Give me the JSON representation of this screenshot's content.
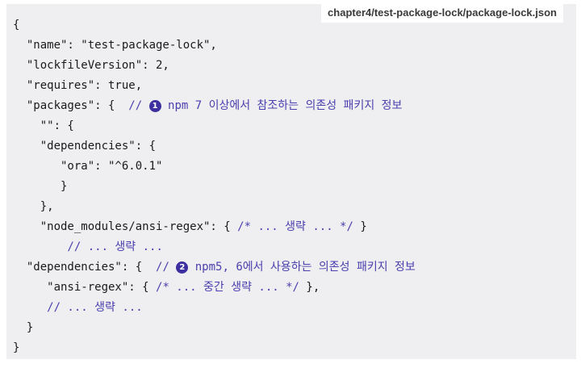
{
  "header": {
    "filename": "chapter4/test-package-lock/package-lock.json"
  },
  "code": {
    "l1": "{",
    "l2": "  \"name\": \"test-package-lock\",",
    "l3": "  \"lockfileVersion\": 2,",
    "l4": "  \"requires\": true,",
    "l5_code": "  \"packages\": {  ",
    "l5_c_pre": "// ",
    "l5_marker": "1",
    "l5_c_post": " npm 7 이상에서 참조하는 의존성 패키지 정보",
    "l6": "    \"\": {",
    "l7": "    \"dependencies\": {",
    "l8": "       \"ora\": \"^6.0.1\"",
    "l9": "       }",
    "l10": "    },",
    "l11_code": "    \"node_modules/ansi-regex\": { ",
    "l11_comment": "/* ... 생략 ... */",
    "l11_end": " }",
    "l12": "        // ... 생략 ...",
    "l13_code": "  \"dependencies\": {  ",
    "l13_c_pre": "// ",
    "l13_marker": "2",
    "l13_c_post": " npm5, 6에서 사용하는 의존성 패키지 정보",
    "l14_code": "     \"ansi-regex\": { ",
    "l14_comment": "/* ... 중간 생략 ... */",
    "l14_end": " },",
    "l15": "     // ... 생략 ...",
    "l16": "  }",
    "l17": "}"
  }
}
